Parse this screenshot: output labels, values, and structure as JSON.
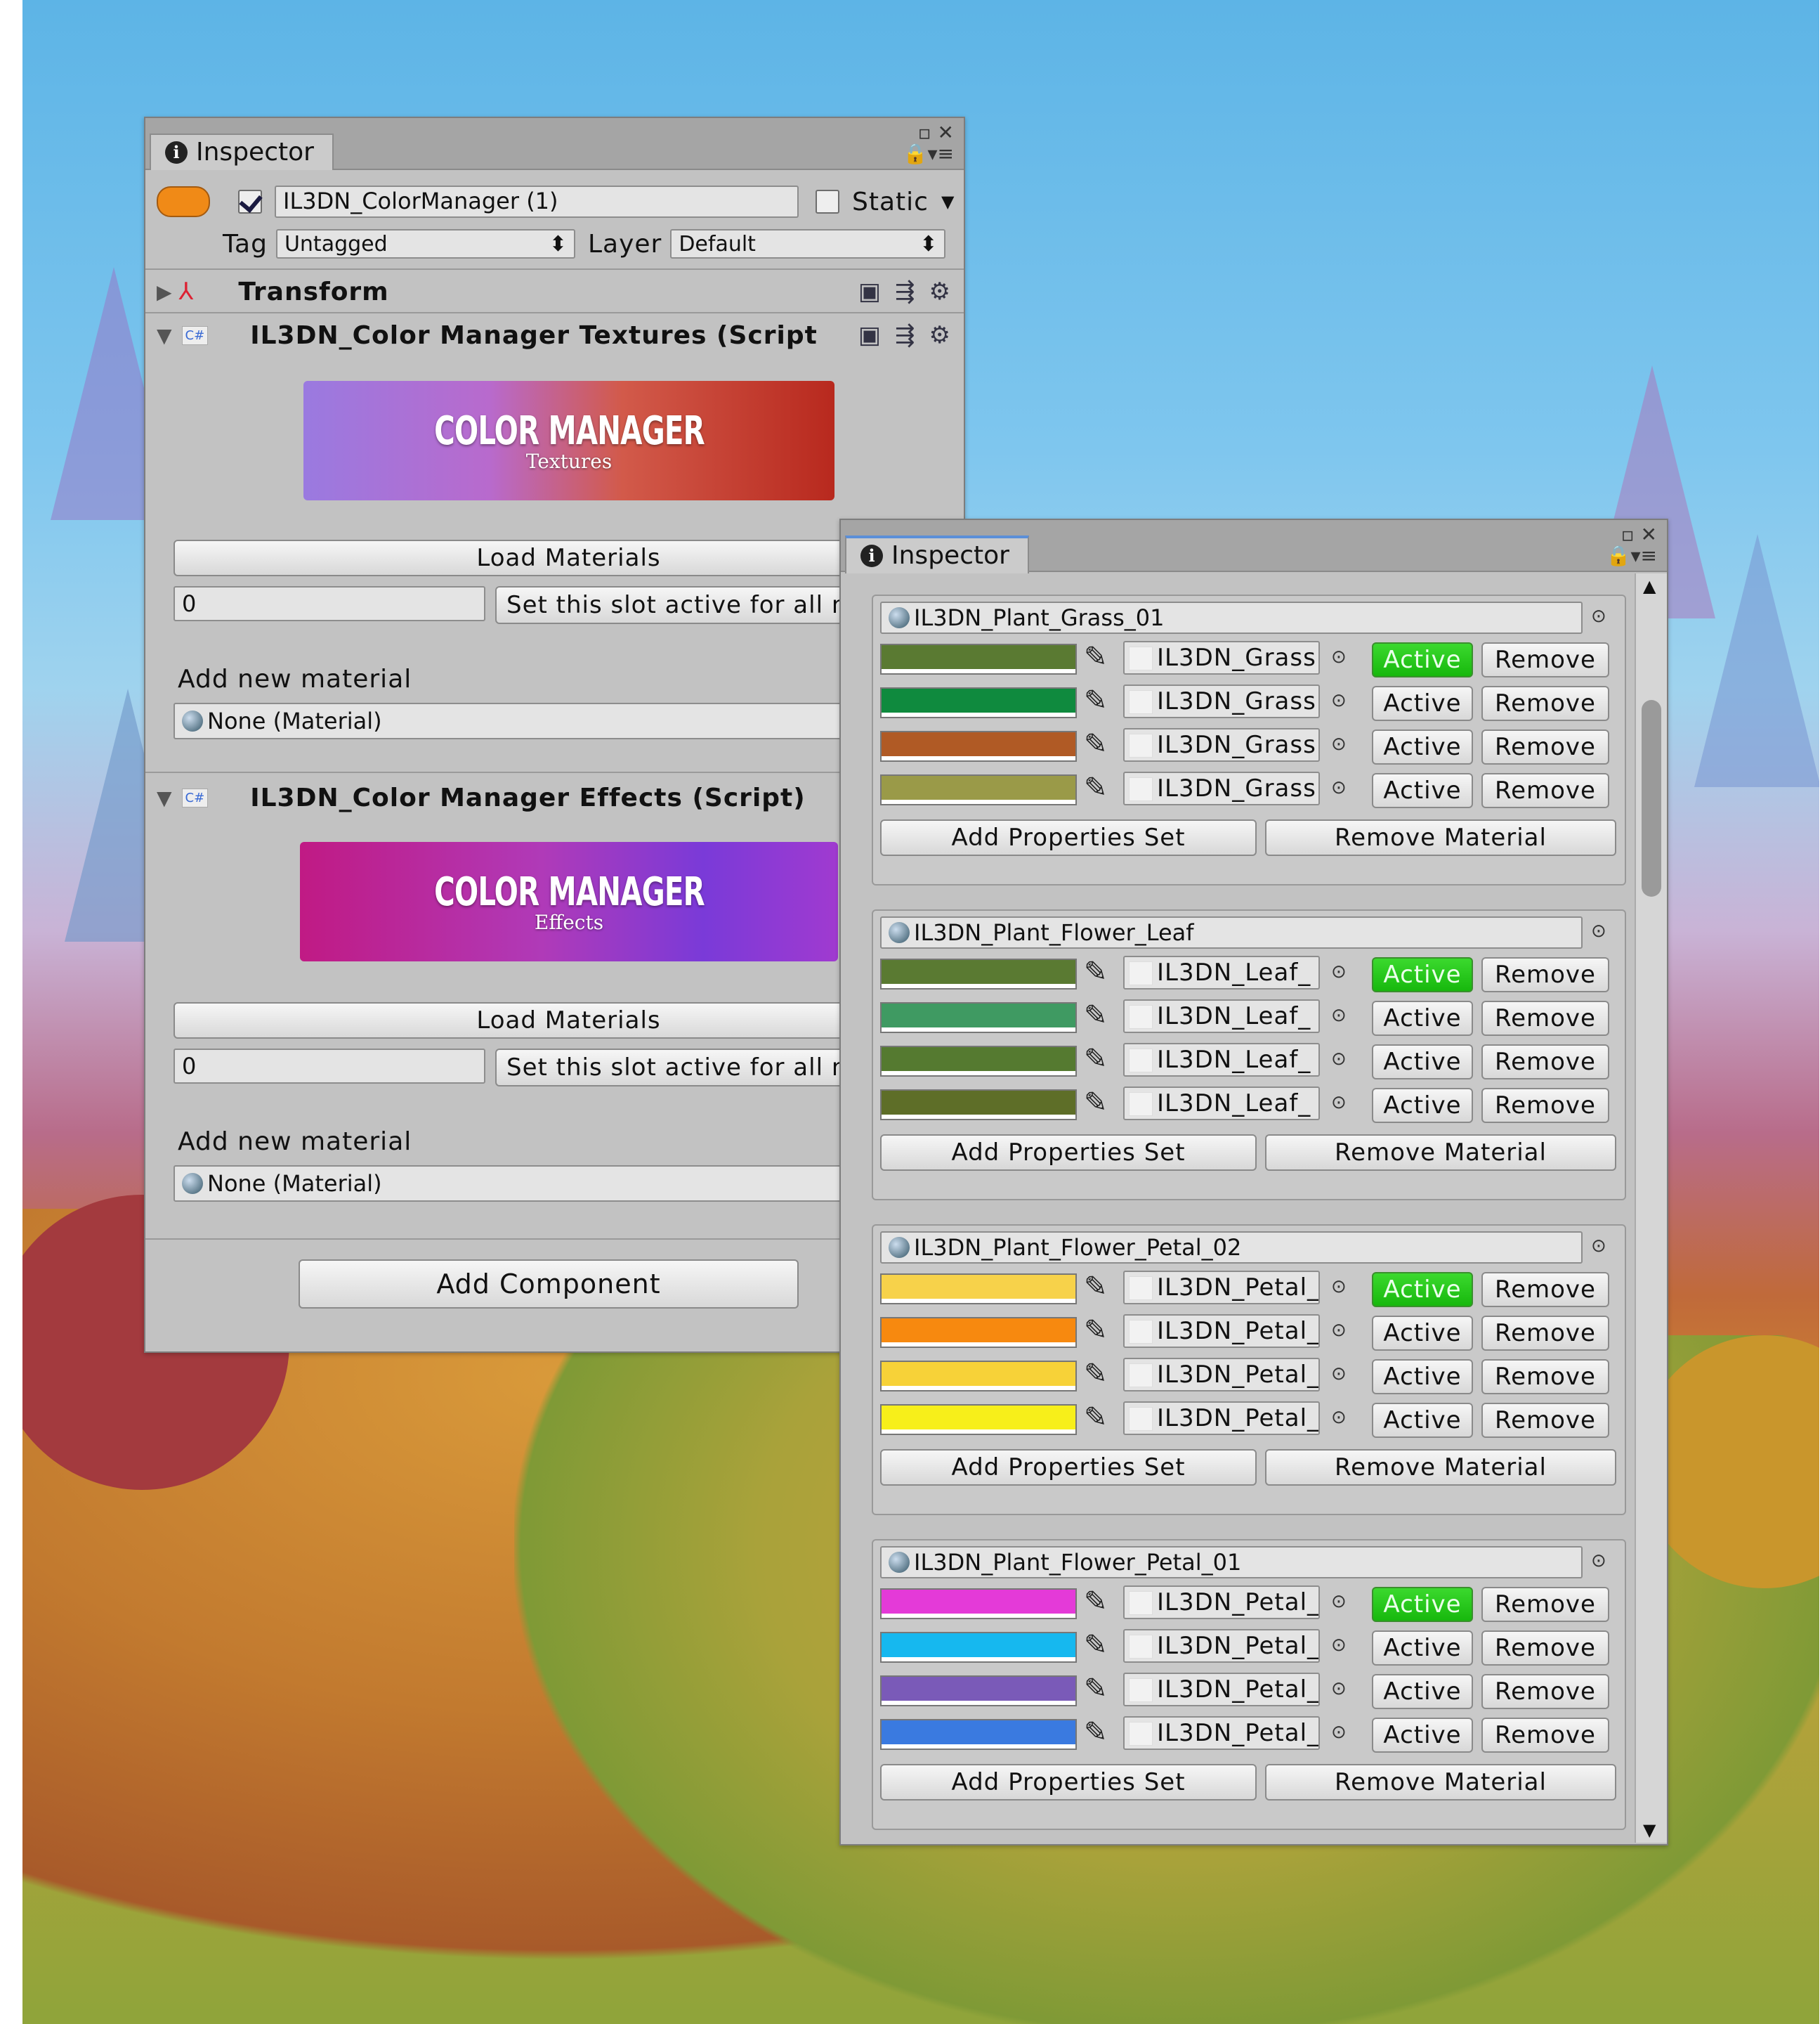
{
  "left_inspector": {
    "tab_label": "Inspector",
    "object_name": "IL3DN_ColorManager (1)",
    "static_label": "Static",
    "tag_label": "Tag",
    "tag_value": "Untagged",
    "layer_label": "Layer",
    "layer_value": "Default",
    "transform_label": "Transform",
    "component1": {
      "title": "IL3DN_Color Manager Textures (Script",
      "banner_title": "COLOR MANAGER",
      "banner_sub": "Textures",
      "load_button": "Load Materials",
      "slot_value": "0",
      "slot_button": "Set this slot active for all n",
      "add_label": "Add new material",
      "material_value": "None (Material)"
    },
    "component2": {
      "title": "IL3DN_Color Manager Effects (Script)",
      "banner_title": "COLOR MANAGER",
      "banner_sub": "Effects",
      "load_button": "Load Materials",
      "slot_value": "0",
      "slot_button": "Set this slot active for all n",
      "add_label": "Add new material",
      "material_value": "None (Material)"
    },
    "add_component": "Add Component"
  },
  "right_inspector": {
    "tab_label": "Inspector",
    "materials": [
      {
        "name": "IL3DN_Plant_Grass_01",
        "rows": [
          {
            "color": "#5a7a32",
            "texture": "IL3DN_Grass",
            "active": true
          },
          {
            "color": "#0f8a3e",
            "texture": "IL3DN_Grass",
            "active": false
          },
          {
            "color": "#b05a25",
            "texture": "IL3DN_Grass",
            "active": false
          },
          {
            "color": "#9a9a48",
            "texture": "IL3DN_Grass",
            "active": false
          }
        ]
      },
      {
        "name": "IL3DN_Plant_Flower_Leaf",
        "rows": [
          {
            "color": "#5a7a32",
            "texture": "IL3DN_Leaf_",
            "active": true
          },
          {
            "color": "#3f9a62",
            "texture": "IL3DN_Leaf_",
            "active": false
          },
          {
            "color": "#557a30",
            "texture": "IL3DN_Leaf_",
            "active": false
          },
          {
            "color": "#5e6e28",
            "texture": "IL3DN_Leaf_",
            "active": false
          }
        ]
      },
      {
        "name": "IL3DN_Plant_Flower_Petal_02",
        "rows": [
          {
            "color": "#f7d24a",
            "texture": "IL3DN_Petal_",
            "active": true
          },
          {
            "color": "#f7890f",
            "texture": "IL3DN_Petal_",
            "active": false
          },
          {
            "color": "#f7d238",
            "texture": "IL3DN_Petal_",
            "active": false
          },
          {
            "color": "#f7ef1a",
            "texture": "IL3DN_Petal_",
            "active": false
          }
        ]
      },
      {
        "name": "IL3DN_Plant_Flower_Petal_01",
        "rows": [
          {
            "color": "#e43ad8",
            "texture": "IL3DN_Petal_",
            "active": true
          },
          {
            "color": "#16b8ef",
            "texture": "IL3DN_Petal_",
            "active": false
          },
          {
            "color": "#7a5ab8",
            "texture": "IL3DN_Petal_",
            "active": false
          },
          {
            "color": "#3a7ae0",
            "texture": "IL3DN_Petal_",
            "active": false
          }
        ]
      }
    ],
    "active_label": "Active",
    "remove_label": "Remove",
    "add_set_label": "Add Properties Set",
    "remove_material_label": "Remove Material"
  },
  "colors": {
    "active_green": "#22c916",
    "panel_gray": "#c2c2c2"
  }
}
